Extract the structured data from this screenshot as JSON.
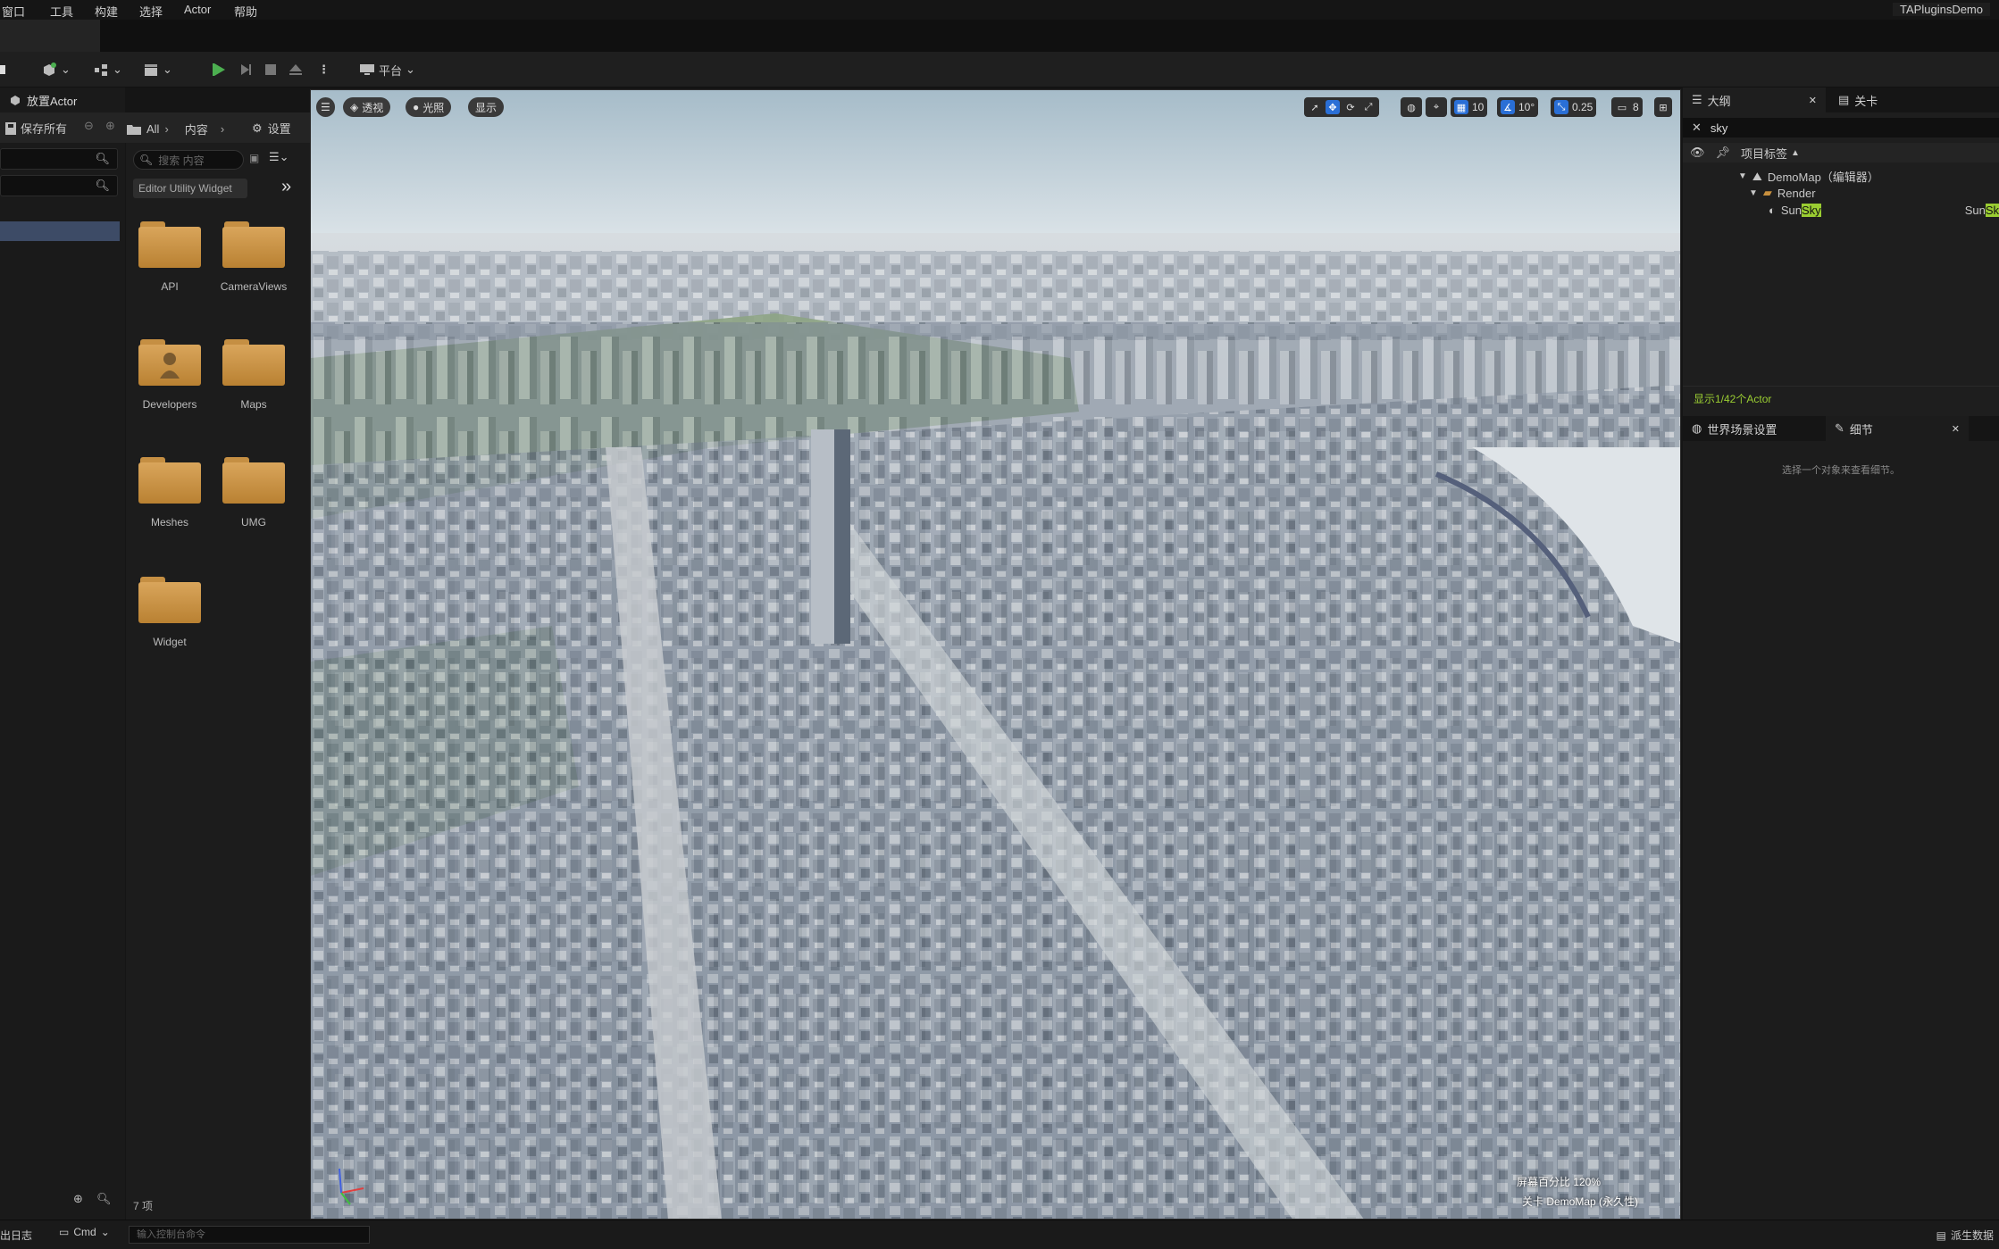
{
  "menu": [
    "窗口",
    "工具",
    "构建",
    "选择",
    "Actor",
    "帮助"
  ],
  "project_name": "TAPluginsDemo",
  "toolbar": {
    "platform_label": "平台"
  },
  "left_panel": {
    "place_actor_label": "放置Actor"
  },
  "content_browser": {
    "save_all_label": "保存所有",
    "path": [
      "All",
      "内容"
    ],
    "settings_label": "设置",
    "search_placeholder": "搜索 内容",
    "filter_chip": "Editor Utility Widget",
    "folders": [
      {
        "name": "API",
        "icon": "folder-icon"
      },
      {
        "name": "CameraViews",
        "icon": "folder-icon"
      },
      {
        "name": "Developers",
        "icon": "developer-folder-icon"
      },
      {
        "name": "Maps",
        "icon": "folder-icon"
      },
      {
        "name": "Meshes",
        "icon": "folder-icon"
      },
      {
        "name": "UMG",
        "icon": "folder-icon"
      },
      {
        "name": "Widget",
        "icon": "folder-icon"
      }
    ],
    "item_count": "7 项"
  },
  "viewport": {
    "view_mode": "透视",
    "lighting": "光照",
    "show": "显示",
    "grid_snap": "10",
    "rotation_snap": "10°",
    "scale_snap": "0.25",
    "camera_speed": "8",
    "screen_percentage": "屏幕百分比 120%",
    "level_info": "关卡  DemoMap (永久性)"
  },
  "outliner": {
    "tab_label": "大纲",
    "levels_tab_label": "关卡",
    "search_value": "sky",
    "column_label": "项目标签",
    "tree": [
      {
        "label": "DemoMap（编辑器）",
        "depth": 0
      },
      {
        "label": "Render",
        "depth": 1
      },
      {
        "label_prefix": "Sun",
        "label_match": "Sky",
        "depth": 2,
        "type_prefix": "Sun",
        "type_match": "Sk"
      }
    ],
    "footer": "显示1/42个Actor"
  },
  "details": {
    "world_settings_tab": "世界场景设置",
    "details_tab": "细节",
    "empty_message": "选择一个对象来查看细节。"
  },
  "statusbar": {
    "output_log": "出日志",
    "cmd_label": "Cmd",
    "console_placeholder": "输入控制台命令",
    "derived_data": "派生数据"
  },
  "colors": {
    "accent_blue": "#2a6fd6",
    "play_green": "#4caf50",
    "highlight_green": "#9acd32",
    "folder": "#c8903e"
  }
}
